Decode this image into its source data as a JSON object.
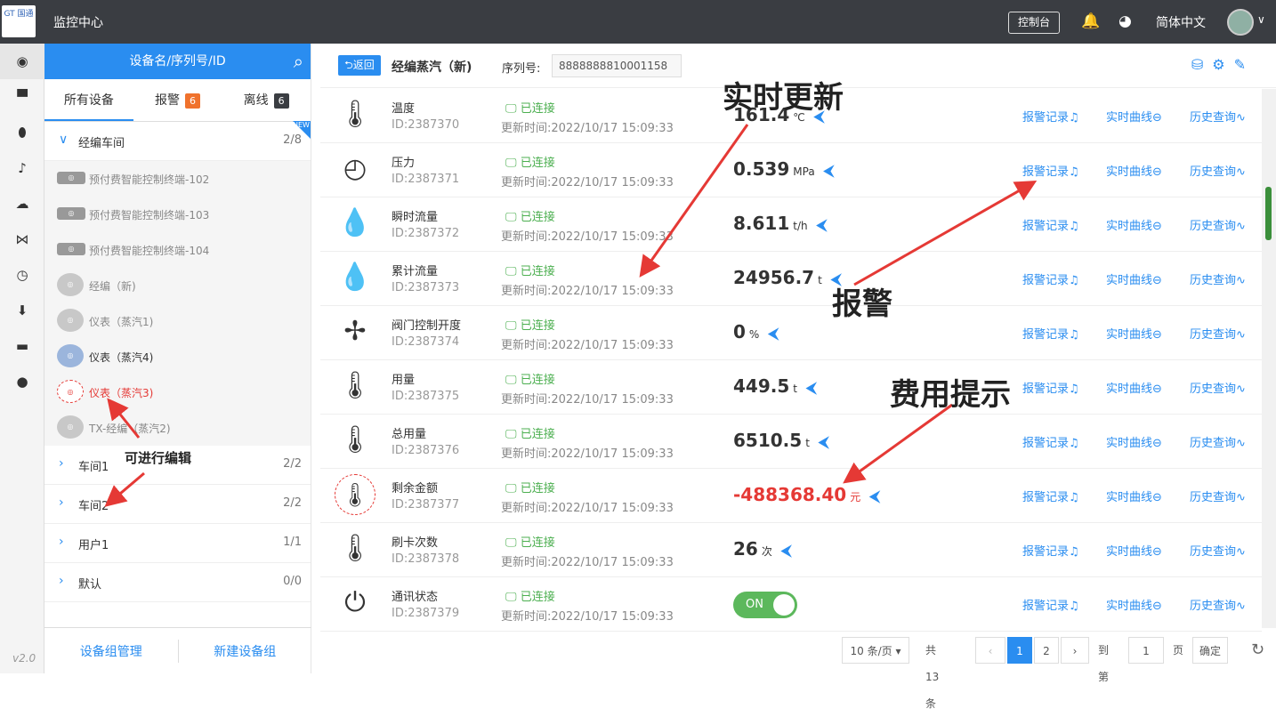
{
  "app": {
    "logo_text": "GT 国通",
    "title": "监控中心",
    "console": "控制台",
    "language": "简体中文",
    "version": "v2.0"
  },
  "icons": {
    "bell": "bell-icon",
    "palette": "palette-icon",
    "search": "search-icon"
  },
  "sidebar_nav": [
    "circle-dot-icon",
    "storefront-icon",
    "location-pin-icon",
    "alarm-bell-icon",
    "cloud-icon",
    "network-icon",
    "clock-icon",
    "download-icon",
    "card-icon",
    "user-icon"
  ],
  "tree": {
    "search_placeholder": "设备名/序列号/ID",
    "tabs": [
      {
        "label": "所有设备",
        "count": ""
      },
      {
        "label": "报警",
        "count": "6"
      },
      {
        "label": "离线",
        "count": "6"
      }
    ],
    "new_badge": "NEW",
    "groups": [
      {
        "name": "经编车间",
        "count": "2/8",
        "expanded": true,
        "devices": [
          {
            "name": "预付费智能控制终端-102",
            "type": "terminal",
            "state": "offline"
          },
          {
            "name": "预付费智能控制终端-103",
            "type": "terminal",
            "state": "offline"
          },
          {
            "name": "预付费智能控制终端-104",
            "type": "terminal",
            "state": "offline"
          },
          {
            "name": "经编（新)",
            "type": "meter",
            "state": "offline"
          },
          {
            "name": "仪表（蒸汽1)",
            "type": "meter",
            "state": "offline"
          },
          {
            "name": "仪表（蒸汽4)",
            "type": "meter",
            "state": "online"
          },
          {
            "name": "仪表（蒸汽3)",
            "type": "meter",
            "state": "alarm"
          },
          {
            "name": "TX-经编（蒸汽2)",
            "type": "meter",
            "state": "offline"
          }
        ]
      },
      {
        "name": "车间1",
        "count": "2/2",
        "expanded": false
      },
      {
        "name": "车间2",
        "count": "2/2",
        "expanded": false
      },
      {
        "name": "用户1",
        "count": "1/1",
        "expanded": false
      },
      {
        "name": "默认",
        "count": "0/0",
        "expanded": false
      }
    ],
    "footer": {
      "manage": "设备组管理",
      "create": "新建设备组"
    }
  },
  "detail": {
    "back": "返回",
    "device_name": "经编蒸汽（新)",
    "serial_label": "序列号:",
    "serial": "8888888810001158",
    "status_text": "已连接",
    "time_prefix": "更新时间:",
    "actions": [
      "报警记录",
      "实时曲线",
      "历史查询"
    ],
    "rows": [
      {
        "name": "温度",
        "id": "ID:2387370",
        "time": "2022/10/17 15:09:33",
        "value": "161.4",
        "unit": "℃",
        "icon": "thermometer-icon"
      },
      {
        "name": "压力",
        "id": "ID:2387371",
        "time": "2022/10/17 15:09:33",
        "value": "0.539",
        "unit": "MPa",
        "icon": "pressure-gauge-icon"
      },
      {
        "name": "瞬时流量",
        "id": "ID:2387372",
        "time": "2022/10/17 15:09:33",
        "value": "8.611",
        "unit": "t/h",
        "icon": "water-drop-icon"
      },
      {
        "name": "累计流量",
        "id": "ID:2387373",
        "time": "2022/10/17 15:09:33",
        "value": "24956.7",
        "unit": "t",
        "icon": "water-drop-icon"
      },
      {
        "name": "阀门控制开度",
        "id": "ID:2387374",
        "time": "2022/10/17 15:09:33",
        "value": "0",
        "unit": "%",
        "icon": "windmill-icon"
      },
      {
        "name": "用量",
        "id": "ID:2387375",
        "time": "2022/10/17 15:09:33",
        "value": "449.5",
        "unit": "t",
        "icon": "thermometer-icon"
      },
      {
        "name": "总用量",
        "id": "ID:2387376",
        "time": "2022/10/17 15:09:33",
        "value": "6510.5",
        "unit": "t",
        "icon": "thermometer-icon"
      },
      {
        "name": "剩余金额",
        "id": "ID:2387377",
        "time": "2022/10/17 15:09:33",
        "value": "-488368.40",
        "unit": "元",
        "icon": "thermometer-icon",
        "alert": true
      },
      {
        "name": "刷卡次数",
        "id": "ID:2387378",
        "time": "2022/10/17 15:09:33",
        "value": "26",
        "unit": "次",
        "icon": "thermometer-icon"
      },
      {
        "name": "通讯状态",
        "id": "ID:2387379",
        "time": "2022/10/17 15:09:33",
        "toggle": "ON",
        "icon": "power-icon"
      }
    ]
  },
  "pager": {
    "page_size": "10 条/页",
    "total": "共 13 条",
    "pages": [
      "1",
      "2"
    ],
    "current": "1",
    "goto_label": "到第",
    "goto_value": "1",
    "page_suffix": "页",
    "confirm": "确定"
  },
  "annotations": {
    "realtime": "实时更新",
    "alarm": "报警",
    "fee": "费用提示",
    "editable": "可进行编辑"
  },
  "colors": {
    "primary": "#2a8df0",
    "topbar": "#3a3d42",
    "connected": "#4caf50",
    "alert": "#e53935",
    "alarm_badge": "#f0722d"
  }
}
